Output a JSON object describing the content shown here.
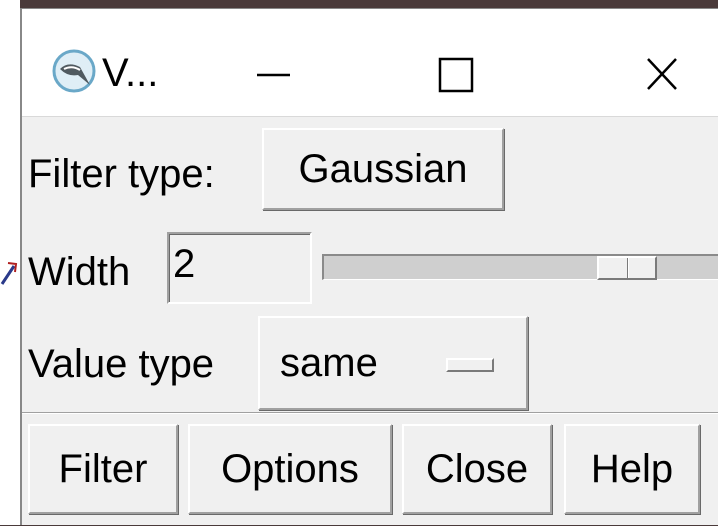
{
  "window": {
    "title": "V..."
  },
  "filter_type": {
    "label": "Filter type:",
    "value": "Gaussian"
  },
  "width": {
    "label": "Width",
    "value": "2",
    "slider_fraction": 0.81
  },
  "value_type": {
    "label": "Value type",
    "value": "same"
  },
  "buttons": {
    "filter": "Filter",
    "options": "Options",
    "close": "Close",
    "help": "Help"
  },
  "icons": {
    "app": "app-icon",
    "minimize": "minimize-icon",
    "maximize": "maximize-icon",
    "close": "close-icon"
  }
}
